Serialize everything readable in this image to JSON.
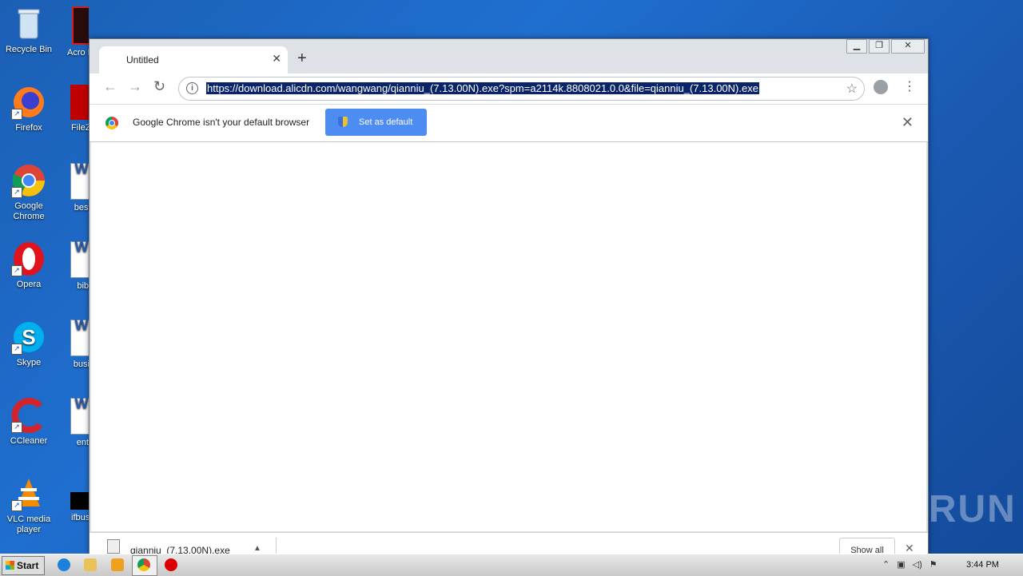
{
  "desktop": {
    "icons_col1": [
      "Recycle Bin",
      "Firefox",
      "Google Chrome",
      "Opera",
      "Skype",
      "CCleaner",
      "VLC media player"
    ],
    "icons_col2": [
      "Acro Read",
      "FileZilla",
      "bestre",
      "bible",
      "busine",
      "entry",
      "ifbusine"
    ]
  },
  "browser": {
    "tab_title": "Untitled",
    "new_tab": "+",
    "url": "https://download.alicdn.com/wangwang/qianniu_(7.13.00N).exe?spm=a2114k.8808021.0.0&file=qianniu_(7.13.00N).exe",
    "infobar_text": "Google Chrome isn't your default browser",
    "set_default_label": "Set as default",
    "download_name": "qianniu_(7.13.00N).exe",
    "show_all": "Show all"
  },
  "watermark": "ANY RUN",
  "taskbar": {
    "start_label": "Start",
    "clock": "3:44 PM"
  }
}
